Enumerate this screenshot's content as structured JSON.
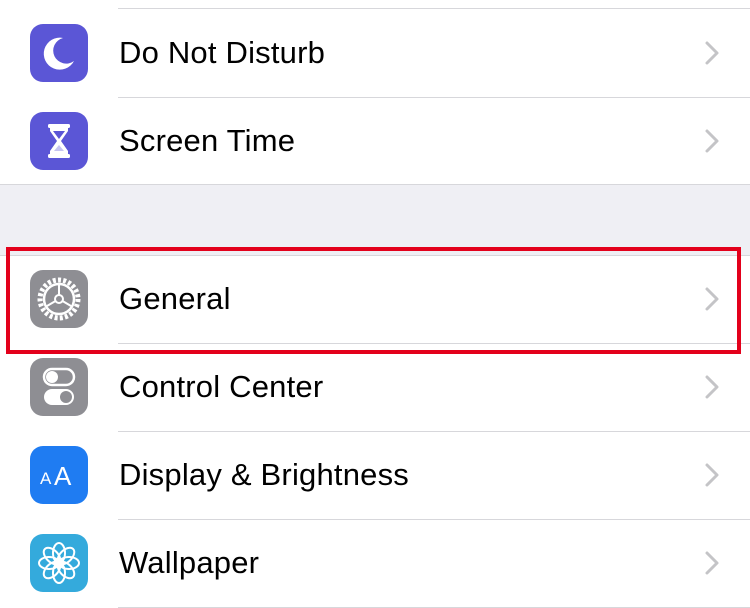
{
  "colors": {
    "separator": "#d7d7db",
    "group_background": "#efeff4",
    "chevron": "#c4c4c7",
    "highlight": "#e3001b"
  },
  "sections": [
    {
      "items": [
        {
          "label": "Do Not Disturb",
          "icon": "moon-icon",
          "icon_color": "#5b56d6"
        },
        {
          "label": "Screen Time",
          "icon": "hourglass-icon",
          "icon_color": "#5b56d6"
        }
      ]
    },
    {
      "items": [
        {
          "label": "General",
          "icon": "gear-icon",
          "icon_color": "#8e8e93",
          "highlighted": true
        },
        {
          "label": "Control Center",
          "icon": "toggle-switches-icon",
          "icon_color": "#8e8e93"
        },
        {
          "label": "Display & Brightness",
          "icon": "text-size-icon",
          "icon_color": "#1f7cf2"
        },
        {
          "label": "Wallpaper",
          "icon": "flower-icon",
          "icon_color": "#34aadc"
        }
      ]
    }
  ]
}
